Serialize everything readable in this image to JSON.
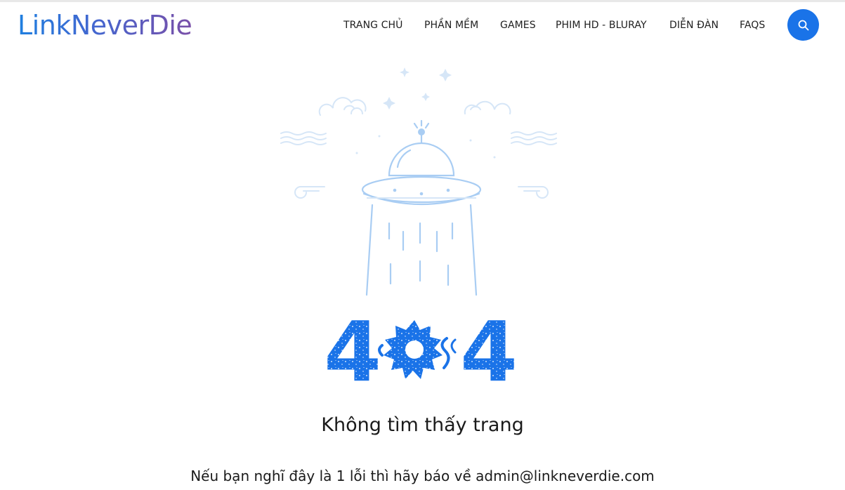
{
  "brand": {
    "logo_text": "LinkNeverDie"
  },
  "nav": {
    "items": [
      {
        "label": "TRANG CHỦ"
      },
      {
        "label": "PHẦN MỀM"
      },
      {
        "label": "GAMES"
      },
      {
        "label": "PHIM HD - BLURAY"
      },
      {
        "label": "DIỄN ĐÀN"
      },
      {
        "label": "FAQS"
      }
    ],
    "search_icon": "search-icon"
  },
  "error": {
    "code_digits": [
      "4",
      "0",
      "4"
    ],
    "title": "Không tìm thấy trang",
    "message": "Nếu bạn nghĩ đây là 1 lỗi thì hãy báo về admin@linkneverdie.com"
  },
  "colors": {
    "accent": "#1a73e8",
    "illustration": "#a9cdf3",
    "illustration_light": "#d6e6f7",
    "text": "#1b1b1b"
  }
}
